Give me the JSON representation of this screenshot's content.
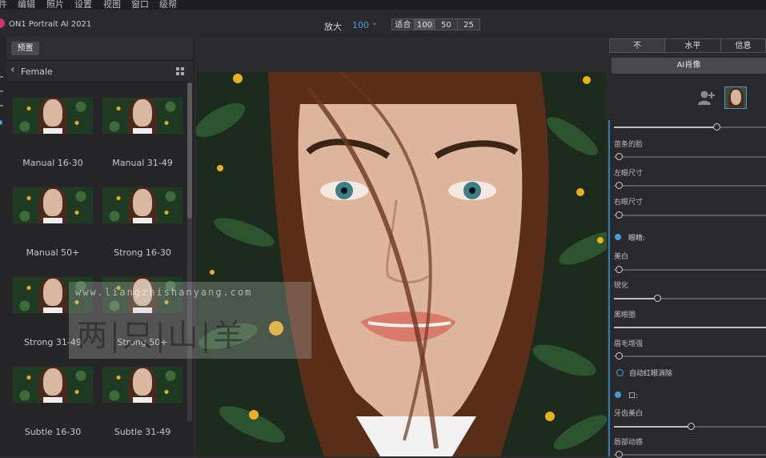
{
  "menu": [
    "件",
    "编辑",
    "照片",
    "设置",
    "视图",
    "窗口",
    "级帮"
  ],
  "app": {
    "title": "ON1 Portrait AI 2021",
    "logo_color": "#d6336c"
  },
  "zoom": {
    "label": "放大",
    "value": "100",
    "buttons": [
      "适合",
      "100",
      "50",
      "25"
    ],
    "active": "100"
  },
  "left_panel": {
    "tab": "预置",
    "category": "Female",
    "presets": [
      {
        "label": "Manual 16-30"
      },
      {
        "label": "Manual 31-49"
      },
      {
        "label": "Manual 50+"
      },
      {
        "label": "Strong 16-30"
      },
      {
        "label": "Strong 31-49"
      },
      {
        "label": "Strong 50+"
      },
      {
        "label": "Subtle 16-30"
      },
      {
        "label": "Subtle 31-49"
      }
    ]
  },
  "watermark": {
    "url": "www.liangzhishanyang.com",
    "text": "两|只|山|羊"
  },
  "right_panel": {
    "tabs": [
      "不",
      "水平",
      "信息"
    ],
    "active_tab": "不",
    "ai_button": "AI肖像",
    "accent_color": "#3da2dc",
    "face_controls": {
      "top_slider": 0.7,
      "sliders": [
        {
          "label": "苗条的脸",
          "value": 0.0
        },
        {
          "label": "左眼尺寸",
          "value": 0.0
        },
        {
          "label": "右眼尺寸",
          "value": 0.0
        }
      ]
    },
    "eyes": {
      "title": "眼睛:",
      "sliders": [
        {
          "label": "美白",
          "value": 0.0
        },
        {
          "label": "锐化",
          "value": 0.28
        },
        {
          "label": "黑眼圈",
          "value": 1.0
        },
        {
          "label": "眉毛增强",
          "value": 0.0
        }
      ],
      "redeye": "自动红眼消除"
    },
    "mouth": {
      "title": "口:",
      "sliders": [
        {
          "label": "牙齿美白",
          "value": 0.5
        },
        {
          "label": "唇部动感",
          "value": 0.0
        }
      ]
    }
  }
}
